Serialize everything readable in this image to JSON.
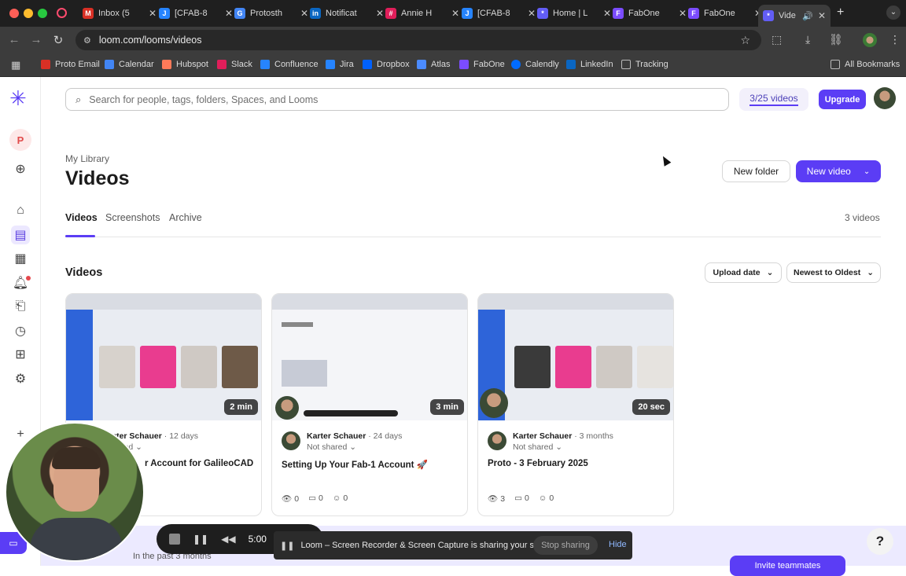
{
  "browser": {
    "tabs": [
      {
        "label": "Inbox (5",
        "color": "#d93025",
        "glyph": "M"
      },
      {
        "label": "[CFAB-8",
        "color": "#2684ff",
        "glyph": "J"
      },
      {
        "label": "Protosth",
        "color": "#4285f4",
        "glyph": "G"
      },
      {
        "label": "Notificat",
        "color": "#0a66c2",
        "glyph": "in"
      },
      {
        "label": "Annie H",
        "color": "#e01e5a",
        "glyph": "#"
      },
      {
        "label": "[CFAB-8",
        "color": "#2684ff",
        "glyph": "J"
      },
      {
        "label": "Home | L",
        "color": "#625df5",
        "glyph": "*"
      },
      {
        "label": "FabOne",
        "color": "#7b4cff",
        "glyph": "F"
      },
      {
        "label": "FabOne",
        "color": "#7b4cff",
        "glyph": "F"
      },
      {
        "label": "Vide",
        "color": "#625df5",
        "glyph": "*"
      }
    ],
    "url": "loom.com/looms/videos",
    "bookmarks": [
      {
        "label": "Proto Email",
        "color": "#d93025"
      },
      {
        "label": "Calendar",
        "color": "#4285f4"
      },
      {
        "label": "Hubspot",
        "color": "#ff7a59"
      },
      {
        "label": "Slack",
        "color": "#e01e5a"
      },
      {
        "label": "Confluence",
        "color": "#2684ff"
      },
      {
        "label": "Jira",
        "color": "#2684ff"
      },
      {
        "label": "Dropbox",
        "color": "#0061fe"
      },
      {
        "label": "Atlas",
        "color": "#4b8bff"
      },
      {
        "label": "FabOne",
        "color": "#7b4cff"
      },
      {
        "label": "Calendly",
        "color": "#006bff"
      },
      {
        "label": "LinkedIn",
        "color": "#0a66c2"
      },
      {
        "label": "Tracking",
        "color": "#9a9a9a"
      }
    ],
    "all_bookmarks": "All Bookmarks"
  },
  "app": {
    "search_placeholder": "Search for people, tags, folders, Spaces, and Looms",
    "quota": "3/25 videos",
    "upgrade": "Upgrade",
    "workspace_initial": "P",
    "breadcrumb": "My Library",
    "title": "Videos",
    "new_folder": "New folder",
    "new_video": "New video",
    "tabs": [
      "Videos",
      "Screenshots",
      "Archive"
    ],
    "video_count": "3 videos",
    "section_heading": "Videos",
    "sort_field": "Upload date",
    "sort_order": "Newest to Oldest",
    "accent": "#5b3df5"
  },
  "videos": [
    {
      "author": "rter Schauer",
      "age": "12 days",
      "share": "red",
      "title": "r Account for GalileoCAD",
      "duration": "2 min",
      "views": "",
      "comments": "",
      "reactions": ""
    },
    {
      "author": "Karter Schauer",
      "age": "24 days",
      "share": "Not shared",
      "title": "Setting Up Your Fab-1 Account 🚀",
      "duration": "3 min",
      "views": "0",
      "comments": "0",
      "reactions": "0"
    },
    {
      "author": "Karter Schauer",
      "age": "3 months",
      "share": "Not shared",
      "title": "Proto - 3 February 2025",
      "duration": "20 sec",
      "views": "3",
      "comments": "0",
      "reactions": "0"
    }
  ],
  "recorder": {
    "timer": "5:00",
    "sharing_text": "Loom – Screen Recorder & Screen Capture is sharing your screen.",
    "stop_sharing": "Stop sharing",
    "hide": "Hide"
  },
  "banner": {
    "past": "In the past 3 months",
    "invite": "Invite teammates"
  },
  "help": "?"
}
